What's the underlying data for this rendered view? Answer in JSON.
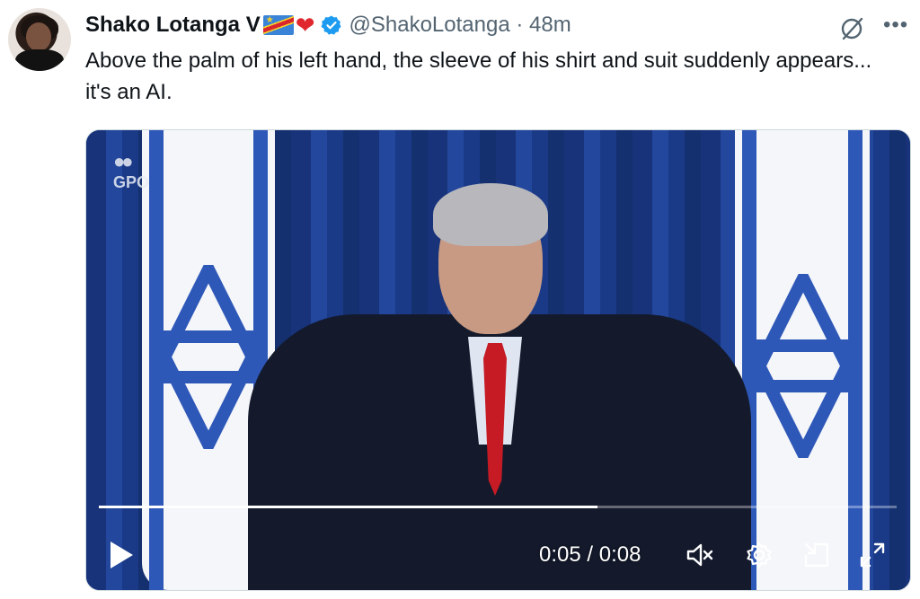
{
  "tweet": {
    "author_name": "Shako Lotanga V",
    "handle_time": "@ShakoLotanga · 48m",
    "text": "Above the palm of his left hand, the sleeve of his shirt and suit suddenly appears... it's an AI."
  },
  "video": {
    "watermark": "GPO",
    "current_time": "0:05",
    "separator": "/",
    "duration": "0:08",
    "progress_fraction": 0.625
  },
  "icons": {
    "verified": "verified-badge-icon",
    "grok": "grok-icon",
    "more": "more-icon",
    "play": "play-icon",
    "mute": "muted-speaker-icon",
    "settings": "settings-gear-icon",
    "pip": "picture-in-picture-icon",
    "fullscreen": "fullscreen-icon"
  },
  "colors": {
    "verified_blue": "#1d9bf0",
    "heart_red": "#e0272e",
    "secondary_text": "#536471"
  }
}
